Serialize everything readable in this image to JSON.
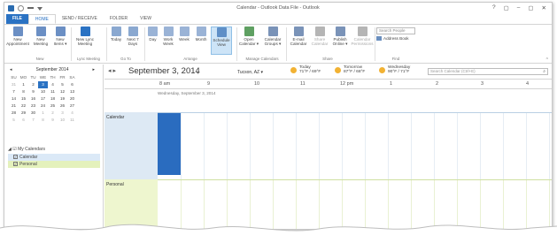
{
  "window": {
    "title": "Calendar - Outlook Data File - Outlook",
    "controls": [
      "?",
      "▢",
      "–",
      "▢",
      "✕"
    ]
  },
  "tabs": [
    {
      "label": "FILE"
    },
    {
      "label": "HOME"
    },
    {
      "label": "SEND / RECEIVE"
    },
    {
      "label": "FOLDER"
    },
    {
      "label": "VIEW"
    }
  ],
  "ribbon": {
    "buttons": [
      {
        "label1": "New",
        "label2": "Appointment",
        "color": "#6b8fc4"
      },
      {
        "label1": "New",
        "label2": "Meeting",
        "color": "#6b8fc4"
      },
      {
        "label1": "New",
        "label2": "Items ▾",
        "color": "#6b8fc4"
      },
      {
        "label1": "New Lync",
        "label2": "Meeting",
        "color": "#2a72c3"
      },
      {
        "label1": "Today",
        "label2": "",
        "color": "#8aa8d0"
      },
      {
        "label1": "Next 7",
        "label2": "Days",
        "color": "#8aa8d0"
      },
      {
        "label1": "Day",
        "label2": "",
        "color": "#9ab3d6"
      },
      {
        "label1": "Work",
        "label2": "Week",
        "color": "#9ab3d6"
      },
      {
        "label1": "Week",
        "label2": "",
        "color": "#9ab3d6"
      },
      {
        "label1": "Month",
        "label2": "",
        "color": "#9ab3d6"
      },
      {
        "label1": "Schedule",
        "label2": "View",
        "color": "#5f8fc7"
      },
      {
        "label1": "Open",
        "label2": "Calendar ▾",
        "color": "#5fa062"
      },
      {
        "label1": "Calendar",
        "label2": "Groups ▾",
        "color": "#7a93b8"
      },
      {
        "label1": "E-mail",
        "label2": "Calendar",
        "color": "#7a93b8"
      },
      {
        "label1": "Share",
        "label2": "Calendar",
        "color": "#b5b5b5"
      },
      {
        "label1": "Publish",
        "label2": "Online ▾",
        "color": "#7a93b8"
      },
      {
        "label1": "Calendar",
        "label2": "Permissions",
        "color": "#b5b5b5"
      }
    ],
    "groups": [
      "New",
      "Lync Meeting",
      "Go To",
      "Arrange",
      "Manage Calendars",
      "Share",
      "Find"
    ],
    "search_people_placeholder": "Search People",
    "address_book": "Address Book",
    "collapse": "^"
  },
  "minical": {
    "prev": "◂",
    "next": "▸",
    "month": "September 2014",
    "dow": [
      "SU",
      "MO",
      "TU",
      "WE",
      "TH",
      "FR",
      "SA"
    ],
    "weeks": [
      [
        "31",
        "1",
        "2",
        "3",
        "4",
        "5",
        "6"
      ],
      [
        "7",
        "8",
        "9",
        "10",
        "11",
        "12",
        "13"
      ],
      [
        "14",
        "15",
        "16",
        "17",
        "18",
        "19",
        "20"
      ],
      [
        "21",
        "22",
        "23",
        "24",
        "25",
        "26",
        "27"
      ],
      [
        "28",
        "29",
        "30",
        "1",
        "2",
        "3",
        "4"
      ],
      [
        "5",
        "6",
        "7",
        "8",
        "9",
        "10",
        "11"
      ]
    ]
  },
  "my_calendars": {
    "header": "◢ ☑ My Calendars",
    "items": [
      {
        "label": "Calendar",
        "checked": "✓"
      },
      {
        "label": "Personal",
        "checked": "✓"
      }
    ]
  },
  "main": {
    "arrows": "◂  ▸",
    "date": "September 3, 2014",
    "date_dropdown": "▾",
    "location": "Tucson, AZ  ▾",
    "weather": [
      {
        "day": "Today",
        "temp": "71°F / 69°F"
      },
      {
        "day": "Tomorrow",
        "temp": "87°F / 68°F"
      },
      {
        "day": "Wednesday",
        "temp": "90°F / 71°F"
      }
    ],
    "search_placeholder": "Search Calendar (Ctrl+E)",
    "search_icon": "⌕",
    "hours": [
      "8 am",
      "9",
      "10",
      "11",
      "12 pm",
      "1",
      "2",
      "3",
      "4"
    ],
    "date_subheader": "Wednesday, September 3, 2014",
    "rows": [
      {
        "label": "Calendar"
      },
      {
        "label": "Personal"
      }
    ]
  }
}
